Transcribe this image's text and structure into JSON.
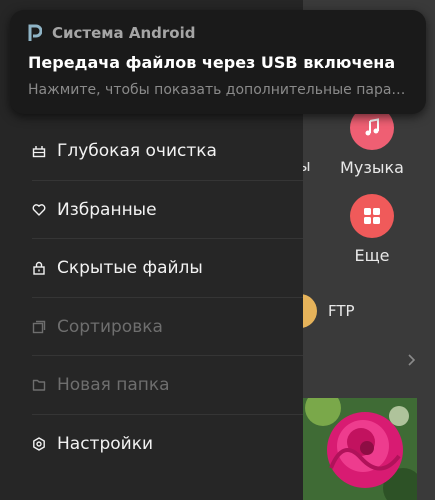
{
  "notification": {
    "app_name": "Система Android",
    "title": "Передача файлов через USB включена",
    "text": "Нажмите, чтобы показать дополнительные параметры."
  },
  "drawer": {
    "items": [
      {
        "label": "Глубокая очистка",
        "icon": "deep-clean-icon",
        "enabled": true
      },
      {
        "label": "Избранные",
        "icon": "heart-icon",
        "enabled": true
      },
      {
        "label": "Скрытые файлы",
        "icon": "lock-icon",
        "enabled": true
      },
      {
        "label": "Сортировка",
        "icon": "sort-icon",
        "enabled": false
      },
      {
        "label": "Новая папка",
        "icon": "new-folder-icon",
        "enabled": false
      },
      {
        "label": "Настройки",
        "icon": "gear-icon",
        "enabled": true
      }
    ]
  },
  "background": {
    "categories": [
      {
        "label": "Музыка",
        "icon": "music-icon",
        "color": "#ef5f73"
      },
      {
        "label": "Еще",
        "icon": "grid-icon",
        "color": "#f05a5a"
      }
    ],
    "cut_label": "ы",
    "ftp_label": "FTP"
  }
}
